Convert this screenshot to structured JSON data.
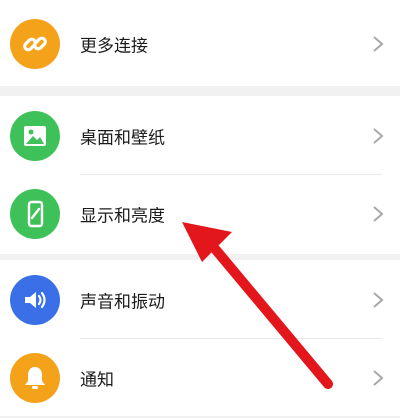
{
  "settings": {
    "items": [
      {
        "label": "更多连接",
        "icon": "link-icon",
        "color": "#f5a21b"
      },
      {
        "label": "桌面和壁纸",
        "icon": "image-icon",
        "color": "#3fc15a"
      },
      {
        "label": "显示和亮度",
        "icon": "phone-brightness-icon",
        "color": "#3fc15a"
      },
      {
        "label": "声音和振动",
        "icon": "speaker-icon",
        "color": "#3a6fe8"
      },
      {
        "label": "通知",
        "icon": "bell-icon",
        "color": "#f5a21b"
      }
    ]
  },
  "colors": {
    "background": "#f1f1f1",
    "row": "#ffffff",
    "annotation_arrow": "#e3161c"
  }
}
